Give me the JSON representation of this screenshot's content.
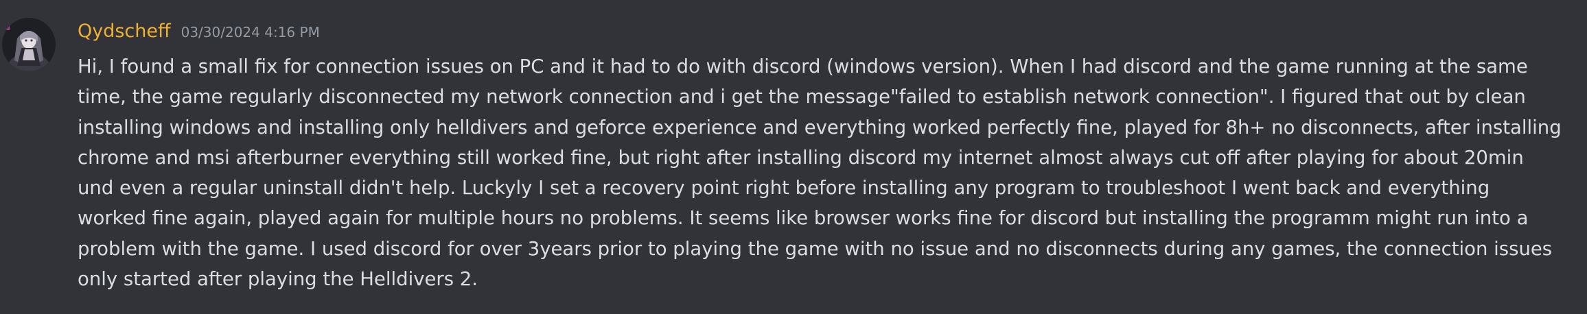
{
  "message": {
    "author": "Qydscheff",
    "timestamp": "03/30/2024 4:16 PM",
    "author_color": "#f0b132",
    "avatar_icon": "anime-character-avatar",
    "lines": [
      "Hi, I found a small fix for connection issues on PC and it had to do with discord (windows version). When I had discord and the game running at the same",
      "time, the game regularly disconnected my network connection and i get the message\"failed to establish network connection\". I figured that out by clean",
      "installing windows and installing only helldivers and geforce experience and everything worked perfectly fine, played for 8h+ no disconnects, after installing",
      "chrome and msi afterburner everything still worked fine, but right after installing discord my internet almost always cut off after playing for about 20min",
      "und even a regular uninstall didn't help. Luckyly I set a recovery point right before installing any program to troubleshoot I went back and everything",
      "worked fine again, played again for multiple hours no problems. It seems like browser works fine for discord but installing the programm might run into a",
      "problem with the game. I used discord for over 3years prior to playing the game with no issue and no disconnects during any games, the connection issues",
      "only started after playing the Helldivers 2."
    ]
  },
  "colors": {
    "background": "#313338",
    "text": "#dbdee1",
    "timestamp": "#949ba4"
  }
}
